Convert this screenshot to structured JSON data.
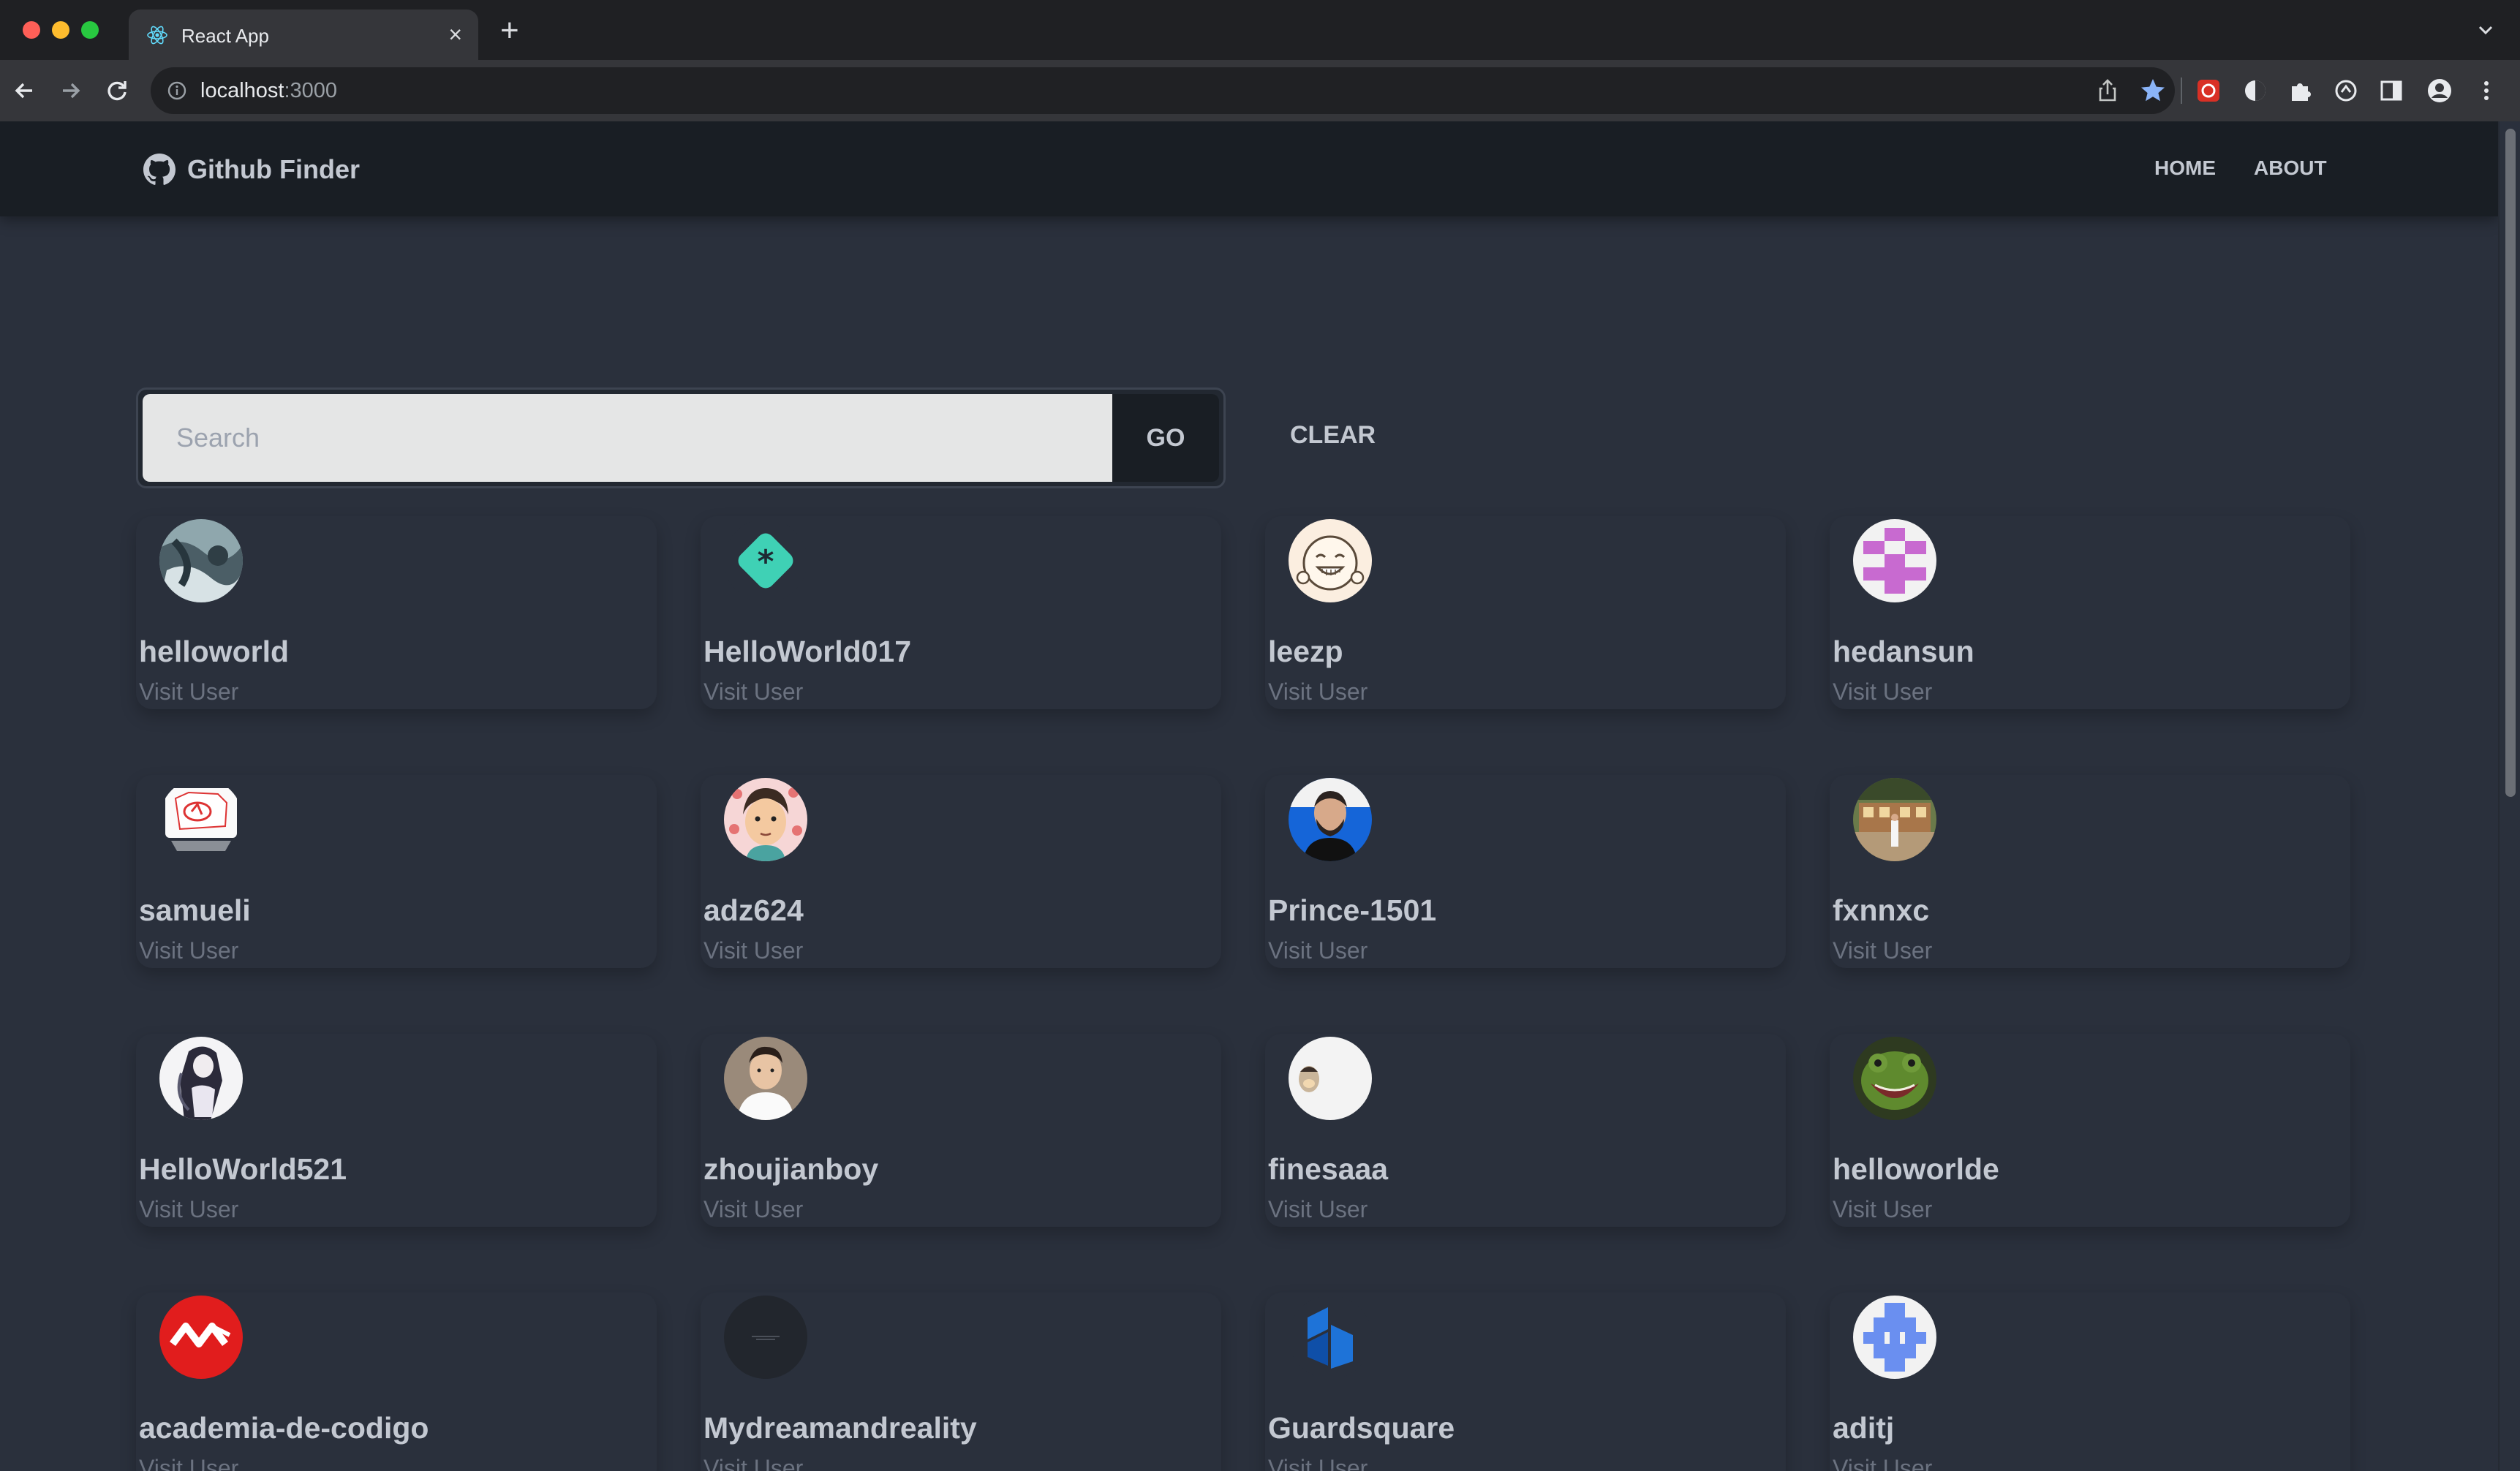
{
  "browser": {
    "tab_title": "React App",
    "url_host": "localhost",
    "url_port": ":3000"
  },
  "app": {
    "brand": "Github Finder",
    "nav": {
      "home": "HOME",
      "about": "ABOUT"
    },
    "search": {
      "placeholder": "Search",
      "go_label": "GO",
      "clear_label": "CLEAR"
    },
    "visit_label": "Visit User",
    "users": [
      {
        "login": "helloworld",
        "avatar": "photo-ocean"
      },
      {
        "login": "HelloWorld017",
        "avatar": "teal-diamond-star"
      },
      {
        "login": "leezp",
        "avatar": "cartoon-face"
      },
      {
        "login": "hedansun",
        "avatar": "pink-identicon"
      },
      {
        "login": "samueli",
        "avatar": "laptop-drawing"
      },
      {
        "login": "adz624",
        "avatar": "cartoon-boy"
      },
      {
        "login": "Prince-1501",
        "avatar": "photo-man-blue"
      },
      {
        "login": "fxnnxc",
        "avatar": "photo-building"
      },
      {
        "login": "HelloWorld521",
        "avatar": "anime-figure"
      },
      {
        "login": "zhoujianboy",
        "avatar": "photo-man-white-shirt"
      },
      {
        "login": "finesaaa",
        "avatar": "small-figure-white"
      },
      {
        "login": "helloworlde",
        "avatar": "green-frog"
      },
      {
        "login": "academia-de-codigo",
        "avatar": "red-logo"
      },
      {
        "login": "Mydreamandreality",
        "avatar": "dark-circle"
      },
      {
        "login": "Guardsquare",
        "avatar": "blue-cube-logo"
      },
      {
        "login": "aditj",
        "avatar": "blue-identicon"
      }
    ]
  }
}
